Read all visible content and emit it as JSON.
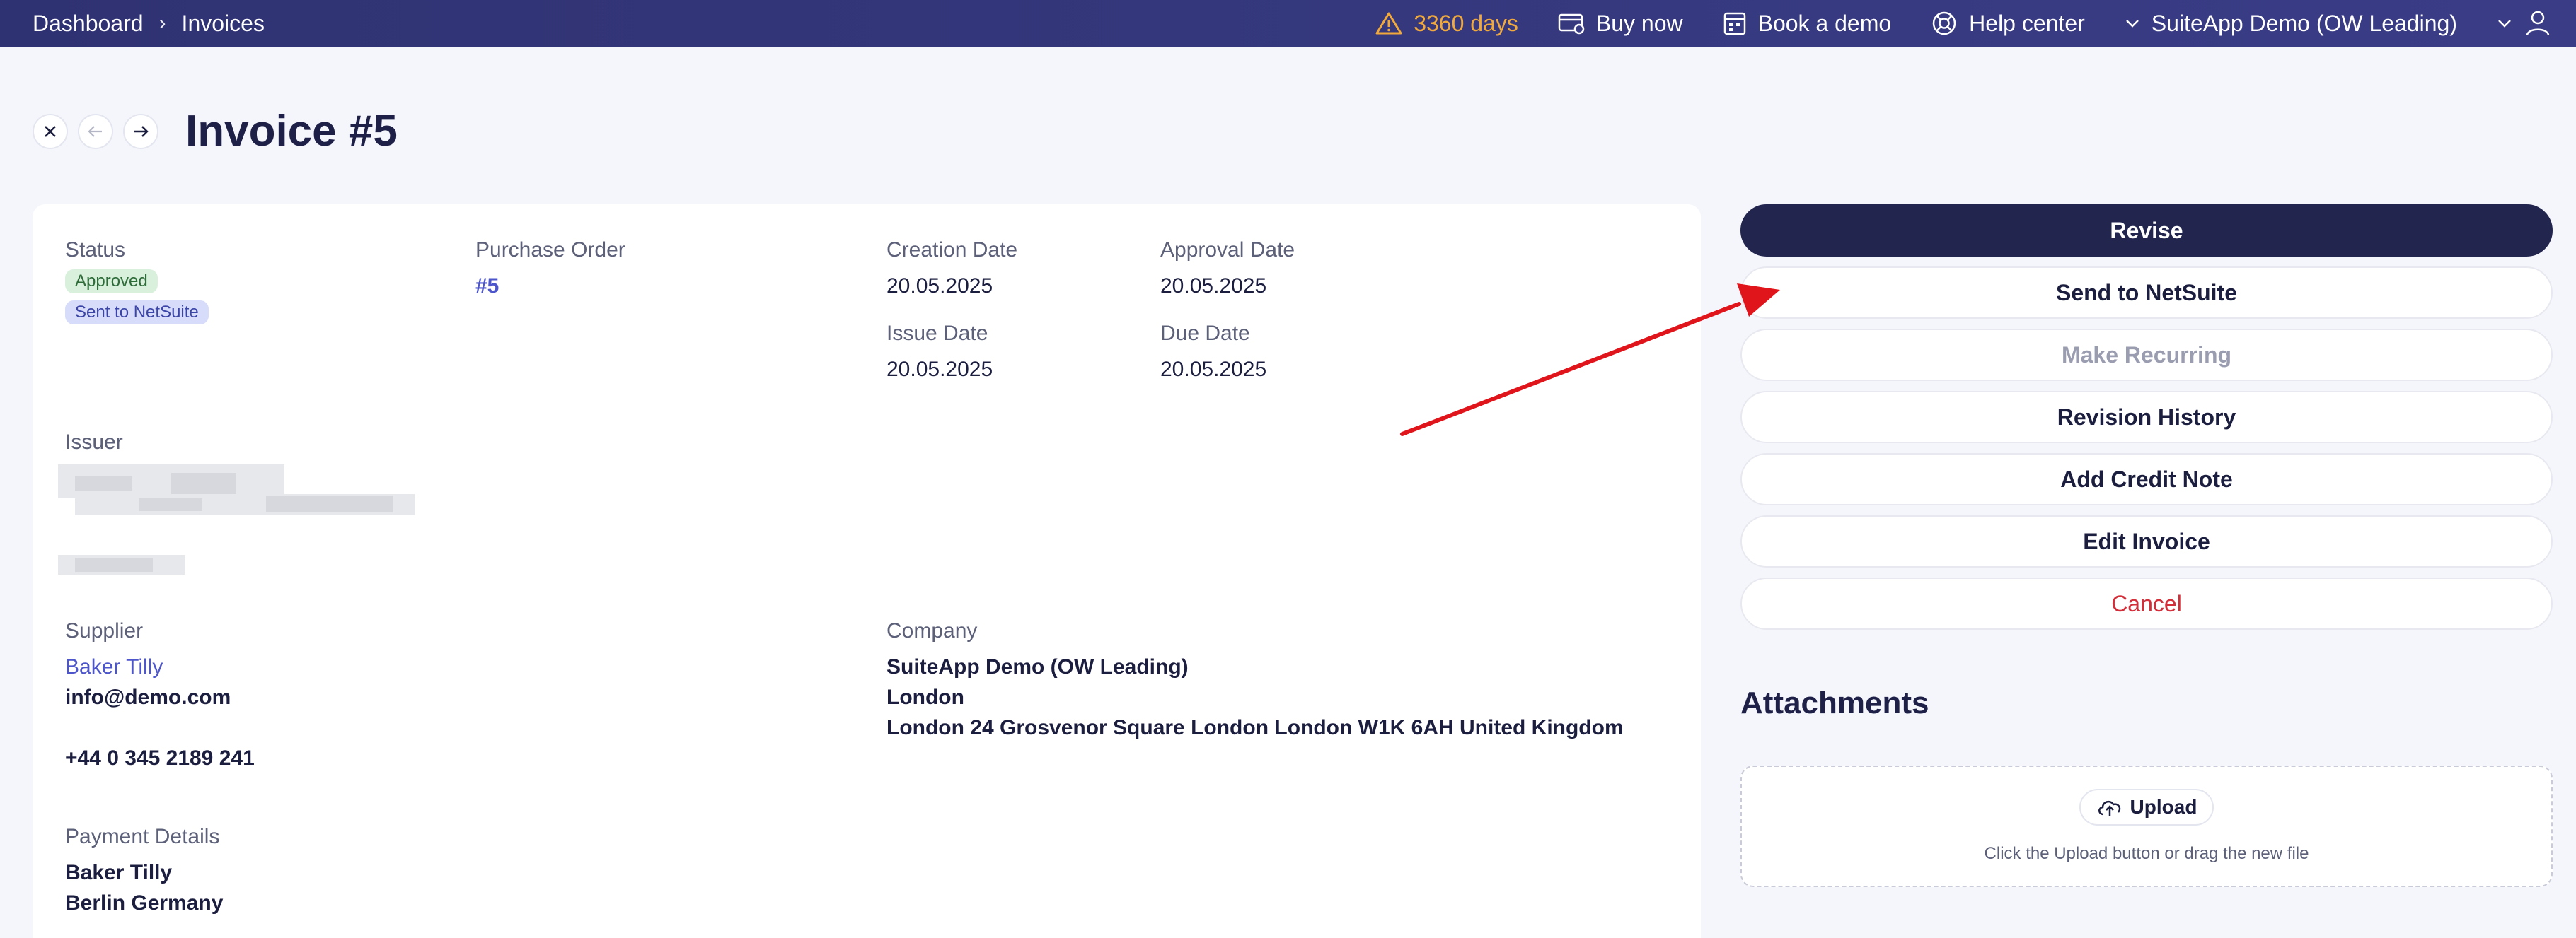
{
  "topbar": {
    "breadcrumbs": [
      "Dashboard",
      "Invoices"
    ],
    "trial_days": "3360 days",
    "buy_now": "Buy now",
    "book_demo": "Book a demo",
    "help_center": "Help center",
    "company": "SuiteApp Demo (OW Leading)"
  },
  "header": {
    "title": "Invoice #5"
  },
  "details": {
    "status_label": "Status",
    "status_badges": [
      "Approved",
      "Sent to NetSuite"
    ],
    "po_label": "Purchase Order",
    "po_value": "#5",
    "creation_date_label": "Creation Date",
    "creation_date": "20.05.2025",
    "approval_date_label": "Approval Date",
    "approval_date": "20.05.2025",
    "issue_date_label": "Issue Date",
    "issue_date": "20.05.2025",
    "due_date_label": "Due Date",
    "due_date": "20.05.2025",
    "issuer_label": "Issuer",
    "supplier_label": "Supplier",
    "supplier_name": "Baker Tilly",
    "supplier_email": "info@demo.com",
    "supplier_phone": "+44 0 345 2189 241",
    "company_label": "Company",
    "company_name": "SuiteApp Demo (OW Leading)",
    "company_city": "London",
    "company_address": "London 24 Grosvenor Square London London W1K 6AH United Kingdom",
    "payment_label": "Payment Details",
    "payment_name": "Baker Tilly",
    "payment_location": "Berlin Germany"
  },
  "actions": {
    "revise": "Revise",
    "send": "Send to NetSuite",
    "recurring": "Make Recurring",
    "history": "Revision History",
    "credit_note": "Add Credit Note",
    "edit": "Edit Invoice",
    "cancel": "Cancel"
  },
  "attachments": {
    "title": "Attachments",
    "upload": "Upload",
    "hint": "Click the Upload button or drag the new file"
  },
  "colors": {
    "topbar": "#2f3272",
    "primary": "#22264f",
    "link": "#4c55c9",
    "danger": "#d32f3a",
    "warning": "#f2a93b",
    "annotation_arrow": "#e0151b"
  }
}
